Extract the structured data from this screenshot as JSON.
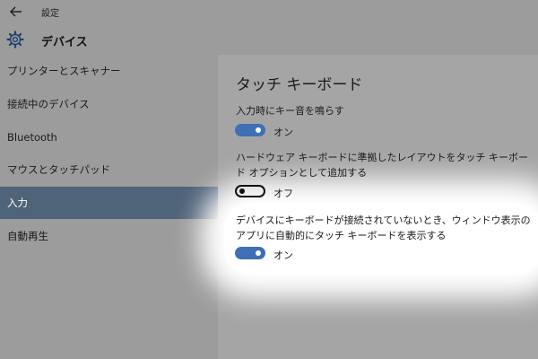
{
  "window": {
    "title": "設定"
  },
  "header": {
    "title": "デバイス",
    "icon": "gear-icon"
  },
  "sidebar": {
    "items": [
      {
        "label": "プリンターとスキャナー",
        "selected": false
      },
      {
        "label": "接続中のデバイス",
        "selected": false
      },
      {
        "label": "Bluetooth",
        "selected": false
      },
      {
        "label": "マウスとタッチパッド",
        "selected": false
      },
      {
        "label": "入力",
        "selected": true
      },
      {
        "label": "自動再生",
        "selected": false
      }
    ]
  },
  "main": {
    "section_title": "タッチ キーボード",
    "settings": [
      {
        "label": "入力時にキー音を鳴らす",
        "state": "オン",
        "on": true
      },
      {
        "label": "ハードウェア キーボードに準拠したレイアウトをタッチ キーボード オプションとして追加する",
        "state": "オフ",
        "on": false
      },
      {
        "label": "デバイスにキーボードが接続されていないとき、ウィンドウ表示のアプリに自動的にタッチ キーボードを表示する",
        "state": "オン",
        "on": true
      }
    ]
  },
  "colors": {
    "background": "#9c9c9c",
    "selected_item": "#4f6379",
    "toggle_on": "#3f6fb5",
    "highlight": "#ffffff"
  }
}
